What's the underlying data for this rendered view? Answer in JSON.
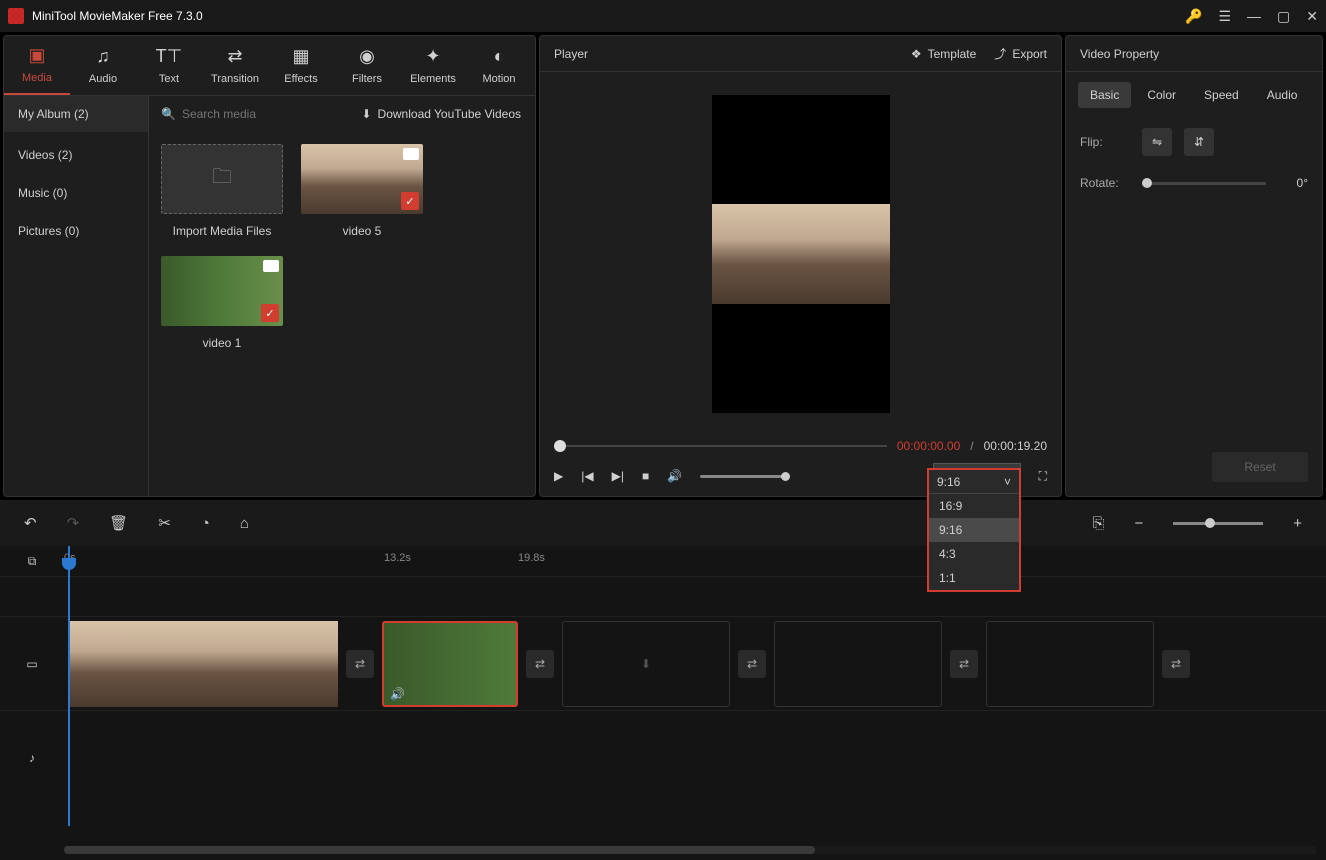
{
  "app": {
    "title": "MiniTool MovieMaker Free 7.3.0"
  },
  "tabs": {
    "media": "Media",
    "audio": "Audio",
    "text": "Text",
    "transition": "Transition",
    "effects": "Effects",
    "filters": "Filters",
    "elements": "Elements",
    "motion": "Motion"
  },
  "album": {
    "label": "My Album (2)",
    "search_placeholder": "Search media",
    "download_yt": "Download YouTube Videos"
  },
  "sidebar": {
    "videos": "Videos (2)",
    "music": "Music (0)",
    "pictures": "Pictures (0)"
  },
  "media": {
    "import": "Import Media Files",
    "video5": "video 5",
    "video1": "video 1"
  },
  "player": {
    "title": "Player",
    "template": "Template",
    "export": "Export",
    "time_current": "00:00:00.00",
    "time_sep": "/",
    "time_total": "00:00:19.20",
    "ratio_selected": "9:16",
    "ratio_options": [
      "16:9",
      "9:16",
      "4:3",
      "1:1"
    ]
  },
  "property": {
    "title": "Video Property",
    "tab_basic": "Basic",
    "tab_color": "Color",
    "tab_speed": "Speed",
    "tab_audio": "Audio",
    "flip_label": "Flip:",
    "rotate_label": "Rotate:",
    "rotate_value": "0°",
    "reset": "Reset"
  },
  "timeline": {
    "t0": "0s",
    "t1": "13.2s",
    "t2": "19.8s"
  }
}
